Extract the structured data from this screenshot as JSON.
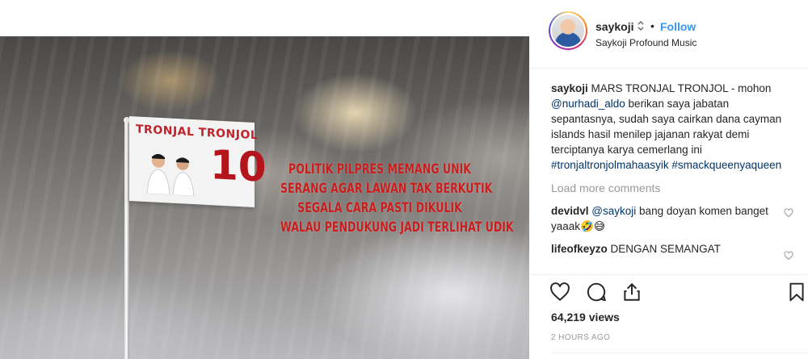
{
  "post": {
    "flag": {
      "title": "TRONJAL TRONJOL",
      "number": "10"
    },
    "poem_lines": [
      "POLITIK PILPRES MEMANG UNIK",
      "SERANG AGAR LAWAN TAK BERKUTIK",
      "SEGALA CARA PASTI DIKULIK",
      "WALAU PENDUKUNG JADI TERLIHAT UDIK"
    ]
  },
  "header": {
    "username": "saykoji",
    "separator": "•",
    "follow_label": "Follow",
    "subtitle": "Saykoji Profound Music"
  },
  "caption": {
    "username": "saykoji",
    "text_1": "MARS TRONJAL TRONJOL - mohon",
    "mention": "@nurhadi_aldo",
    "text_2": "berikan saya jabatan sepantasnya, sudah saya cairkan dana cayman islands hasil menilep jajanan rakyat demi terciptanya karya cemerlang ini",
    "hashtag_1": "#tronjaltronjolmahaasyik",
    "hashtag_2": "#smackqueenyaqueen"
  },
  "load_more_label": "Load more comments",
  "comments": [
    {
      "username": "devidvl",
      "mention": "@saykoji",
      "text": "bang doyan komen banget yaaak🤣😅"
    },
    {
      "username": "lifeofkeyzo",
      "mention": "",
      "text": "DENGAN SEMANGAT"
    }
  ],
  "stats": {
    "views": "64,219 views",
    "time": "2 HOURS AGO"
  },
  "icons": [
    "heart-icon",
    "comment-icon",
    "share-icon",
    "bookmark-icon",
    "verified-toggle-icon"
  ],
  "colors": {
    "follow": "#3897f0",
    "link": "#003569",
    "poem_text": "#c91e1e"
  }
}
